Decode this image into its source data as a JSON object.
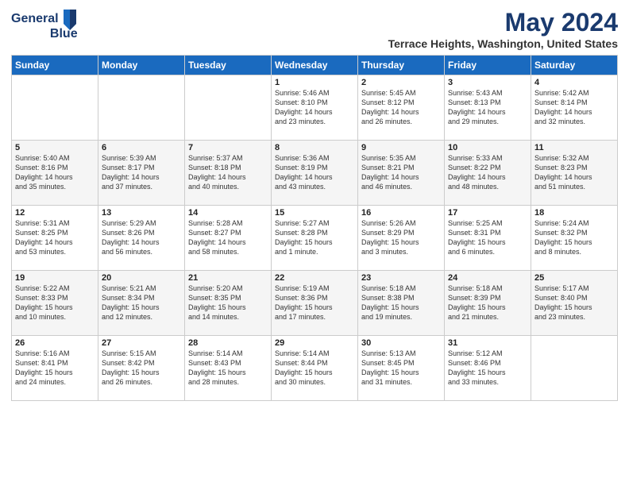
{
  "logo": {
    "line1": "General",
    "line2": "Blue"
  },
  "title": "May 2024",
  "subtitle": "Terrace Heights, Washington, United States",
  "days": [
    "Sunday",
    "Monday",
    "Tuesday",
    "Wednesday",
    "Thursday",
    "Friday",
    "Saturday"
  ],
  "weeks": [
    [
      {
        "day": "",
        "text": ""
      },
      {
        "day": "",
        "text": ""
      },
      {
        "day": "",
        "text": ""
      },
      {
        "day": "1",
        "text": "Sunrise: 5:46 AM\nSunset: 8:10 PM\nDaylight: 14 hours\nand 23 minutes."
      },
      {
        "day": "2",
        "text": "Sunrise: 5:45 AM\nSunset: 8:12 PM\nDaylight: 14 hours\nand 26 minutes."
      },
      {
        "day": "3",
        "text": "Sunrise: 5:43 AM\nSunset: 8:13 PM\nDaylight: 14 hours\nand 29 minutes."
      },
      {
        "day": "4",
        "text": "Sunrise: 5:42 AM\nSunset: 8:14 PM\nDaylight: 14 hours\nand 32 minutes."
      }
    ],
    [
      {
        "day": "5",
        "text": "Sunrise: 5:40 AM\nSunset: 8:16 PM\nDaylight: 14 hours\nand 35 minutes."
      },
      {
        "day": "6",
        "text": "Sunrise: 5:39 AM\nSunset: 8:17 PM\nDaylight: 14 hours\nand 37 minutes."
      },
      {
        "day": "7",
        "text": "Sunrise: 5:37 AM\nSunset: 8:18 PM\nDaylight: 14 hours\nand 40 minutes."
      },
      {
        "day": "8",
        "text": "Sunrise: 5:36 AM\nSunset: 8:19 PM\nDaylight: 14 hours\nand 43 minutes."
      },
      {
        "day": "9",
        "text": "Sunrise: 5:35 AM\nSunset: 8:21 PM\nDaylight: 14 hours\nand 46 minutes."
      },
      {
        "day": "10",
        "text": "Sunrise: 5:33 AM\nSunset: 8:22 PM\nDaylight: 14 hours\nand 48 minutes."
      },
      {
        "day": "11",
        "text": "Sunrise: 5:32 AM\nSunset: 8:23 PM\nDaylight: 14 hours\nand 51 minutes."
      }
    ],
    [
      {
        "day": "12",
        "text": "Sunrise: 5:31 AM\nSunset: 8:25 PM\nDaylight: 14 hours\nand 53 minutes."
      },
      {
        "day": "13",
        "text": "Sunrise: 5:29 AM\nSunset: 8:26 PM\nDaylight: 14 hours\nand 56 minutes."
      },
      {
        "day": "14",
        "text": "Sunrise: 5:28 AM\nSunset: 8:27 PM\nDaylight: 14 hours\nand 58 minutes."
      },
      {
        "day": "15",
        "text": "Sunrise: 5:27 AM\nSunset: 8:28 PM\nDaylight: 15 hours\nand 1 minute."
      },
      {
        "day": "16",
        "text": "Sunrise: 5:26 AM\nSunset: 8:29 PM\nDaylight: 15 hours\nand 3 minutes."
      },
      {
        "day": "17",
        "text": "Sunrise: 5:25 AM\nSunset: 8:31 PM\nDaylight: 15 hours\nand 6 minutes."
      },
      {
        "day": "18",
        "text": "Sunrise: 5:24 AM\nSunset: 8:32 PM\nDaylight: 15 hours\nand 8 minutes."
      }
    ],
    [
      {
        "day": "19",
        "text": "Sunrise: 5:22 AM\nSunset: 8:33 PM\nDaylight: 15 hours\nand 10 minutes."
      },
      {
        "day": "20",
        "text": "Sunrise: 5:21 AM\nSunset: 8:34 PM\nDaylight: 15 hours\nand 12 minutes."
      },
      {
        "day": "21",
        "text": "Sunrise: 5:20 AM\nSunset: 8:35 PM\nDaylight: 15 hours\nand 14 minutes."
      },
      {
        "day": "22",
        "text": "Sunrise: 5:19 AM\nSunset: 8:36 PM\nDaylight: 15 hours\nand 17 minutes."
      },
      {
        "day": "23",
        "text": "Sunrise: 5:18 AM\nSunset: 8:38 PM\nDaylight: 15 hours\nand 19 minutes."
      },
      {
        "day": "24",
        "text": "Sunrise: 5:18 AM\nSunset: 8:39 PM\nDaylight: 15 hours\nand 21 minutes."
      },
      {
        "day": "25",
        "text": "Sunrise: 5:17 AM\nSunset: 8:40 PM\nDaylight: 15 hours\nand 23 minutes."
      }
    ],
    [
      {
        "day": "26",
        "text": "Sunrise: 5:16 AM\nSunset: 8:41 PM\nDaylight: 15 hours\nand 24 minutes."
      },
      {
        "day": "27",
        "text": "Sunrise: 5:15 AM\nSunset: 8:42 PM\nDaylight: 15 hours\nand 26 minutes."
      },
      {
        "day": "28",
        "text": "Sunrise: 5:14 AM\nSunset: 8:43 PM\nDaylight: 15 hours\nand 28 minutes."
      },
      {
        "day": "29",
        "text": "Sunrise: 5:14 AM\nSunset: 8:44 PM\nDaylight: 15 hours\nand 30 minutes."
      },
      {
        "day": "30",
        "text": "Sunrise: 5:13 AM\nSunset: 8:45 PM\nDaylight: 15 hours\nand 31 minutes."
      },
      {
        "day": "31",
        "text": "Sunrise: 5:12 AM\nSunset: 8:46 PM\nDaylight: 15 hours\nand 33 minutes."
      },
      {
        "day": "",
        "text": ""
      }
    ]
  ]
}
